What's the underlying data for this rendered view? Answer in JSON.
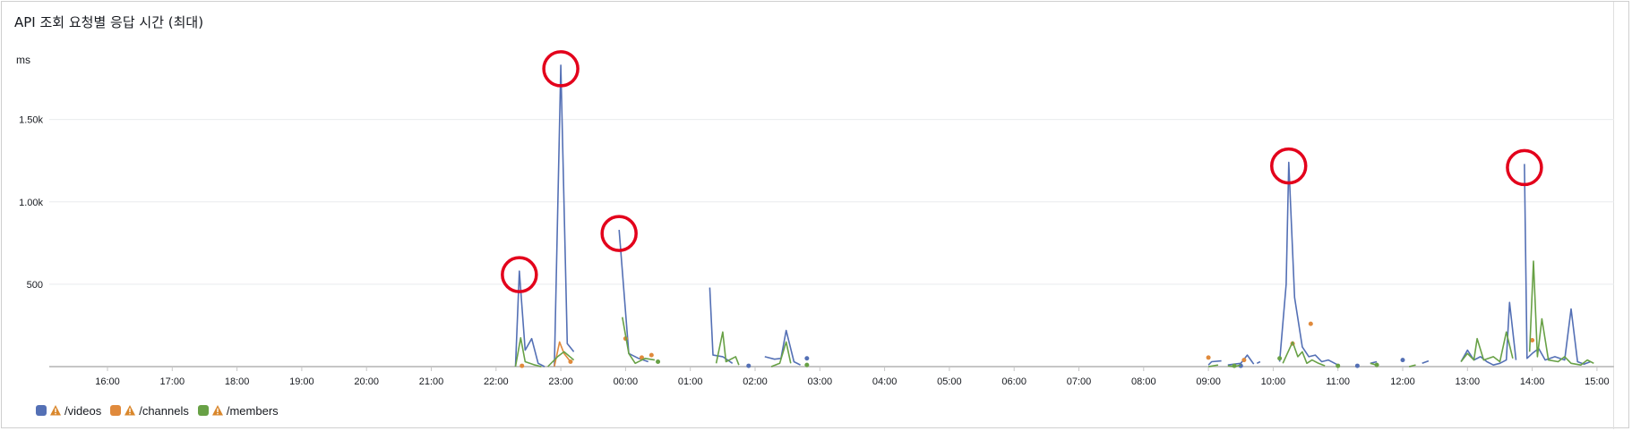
{
  "panel": {
    "title": "API 조회 요청별 응답 시간 (최대)",
    "unit": "ms"
  },
  "colors": {
    "videos": "#5470b5",
    "channels": "#e08a3c",
    "members": "#68a146",
    "grid": "#e9ebed",
    "axis": "#c6c6c6",
    "highlight": "#e3001b",
    "warning": "#d9872c"
  },
  "chart_data": {
    "type": "line",
    "title": "API 조회 요청별 응답 시간 (최대)",
    "ylabel": "ms",
    "ylim": [
      0,
      1900
    ],
    "yticks": [
      {
        "value": 500,
        "label": "500"
      },
      {
        "value": 1000,
        "label": "1.00k"
      },
      {
        "value": 1500,
        "label": "1.50k"
      }
    ],
    "xlim": [
      15.6,
      39.1
    ],
    "xticks": [
      {
        "value": 16,
        "label": "16:00"
      },
      {
        "value": 17,
        "label": "17:00"
      },
      {
        "value": 18,
        "label": "18:00"
      },
      {
        "value": 19,
        "label": "19:00"
      },
      {
        "value": 20,
        "label": "20:00"
      },
      {
        "value": 21,
        "label": "21:00"
      },
      {
        "value": 22,
        "label": "22:00"
      },
      {
        "value": 23,
        "label": "23:00"
      },
      {
        "value": 24,
        "label": "00:00"
      },
      {
        "value": 25,
        "label": "01:00"
      },
      {
        "value": 26,
        "label": "02:00"
      },
      {
        "value": 27,
        "label": "03:00"
      },
      {
        "value": 28,
        "label": "04:00"
      },
      {
        "value": 29,
        "label": "05:00"
      },
      {
        "value": 30,
        "label": "06:00"
      },
      {
        "value": 31,
        "label": "07:00"
      },
      {
        "value": 32,
        "label": "08:00"
      },
      {
        "value": 33,
        "label": "09:00"
      },
      {
        "value": 34,
        "label": "10:00"
      },
      {
        "value": 35,
        "label": "11:00"
      },
      {
        "value": 36,
        "label": "12:00"
      },
      {
        "value": 37,
        "label": "13:00"
      },
      {
        "value": 38,
        "label": "14:00"
      },
      {
        "value": 39,
        "label": "15:00"
      }
    ],
    "grid": true,
    "legend_position": "bottom-left",
    "series": [
      {
        "name": "/videos",
        "segments": [
          [
            [
              22.3,
              0
            ],
            [
              22.36,
              580
            ],
            [
              22.45,
              100
            ],
            [
              22.55,
              170
            ],
            [
              22.65,
              20
            ],
            [
              22.75,
              0
            ]
          ],
          [
            [
              22.9,
              0
            ],
            [
              23.0,
              1830
            ],
            [
              23.1,
              140
            ],
            [
              23.2,
              90
            ]
          ],
          [
            [
              23.9,
              830
            ],
            [
              24.05,
              80
            ],
            [
              24.2,
              50
            ],
            [
              24.35,
              30
            ]
          ],
          [
            [
              25.3,
              480
            ],
            [
              25.35,
              70
            ],
            [
              25.5,
              60
            ],
            [
              25.65,
              20
            ]
          ],
          [
            [
              26.15,
              60
            ],
            [
              26.3,
              45
            ],
            [
              26.4,
              50
            ],
            [
              26.48,
              220
            ],
            [
              26.6,
              30
            ],
            [
              26.7,
              10
            ]
          ],
          [
            [
              33.0,
              10
            ],
            [
              33.05,
              30
            ],
            [
              33.2,
              35
            ]
          ],
          [
            [
              33.3,
              10
            ],
            [
              33.4,
              15
            ],
            [
              33.5,
              20
            ],
            [
              33.6,
              70
            ],
            [
              33.7,
              15
            ]
          ],
          [
            [
              33.75,
              20
            ],
            [
              33.8,
              30
            ]
          ],
          [
            [
              34.1,
              30
            ],
            [
              34.2,
              500
            ],
            [
              34.24,
              1240
            ],
            [
              34.33,
              420
            ],
            [
              34.45,
              120
            ],
            [
              34.55,
              60
            ],
            [
              34.65,
              70
            ],
            [
              34.75,
              30
            ],
            [
              34.85,
              40
            ],
            [
              35.0,
              10
            ]
          ],
          [
            [
              35.5,
              20
            ],
            [
              35.6,
              30
            ]
          ],
          [
            [
              36.3,
              20
            ],
            [
              36.4,
              35
            ]
          ],
          [
            [
              36.9,
              30
            ],
            [
              37.0,
              100
            ],
            [
              37.1,
              40
            ],
            [
              37.2,
              60
            ],
            [
              37.3,
              30
            ],
            [
              37.4,
              10
            ],
            [
              37.5,
              20
            ],
            [
              37.6,
              40
            ],
            [
              37.65,
              390
            ],
            [
              37.75,
              40
            ]
          ],
          [
            [
              37.88,
              1230
            ],
            [
              37.92,
              50
            ],
            [
              38.0,
              80
            ],
            [
              38.1,
              110
            ],
            [
              38.2,
              40
            ],
            [
              38.35,
              60
            ],
            [
              38.5,
              40
            ],
            [
              38.6,
              350
            ],
            [
              38.7,
              30
            ],
            [
              38.8,
              15
            ],
            [
              38.9,
              30
            ]
          ]
        ],
        "dots": [
          [
            26.8,
            50
          ],
          [
            25.9,
            5
          ],
          [
            33.5,
            5
          ],
          [
            35.3,
            5
          ],
          [
            36.0,
            40
          ]
        ]
      },
      {
        "name": "/channels",
        "segments": [
          [
            [
              22.9,
              0
            ],
            [
              22.98,
              150
            ],
            [
              23.05,
              80
            ],
            [
              23.15,
              30
            ]
          ]
        ],
        "dots": [
          [
            22.4,
            5
          ],
          [
            23.15,
            30
          ],
          [
            24.0,
            170
          ],
          [
            24.25,
            55
          ],
          [
            24.4,
            70
          ],
          [
            33.0,
            55
          ],
          [
            33.55,
            40
          ],
          [
            34.3,
            140
          ],
          [
            34.58,
            260
          ],
          [
            38.0,
            160
          ]
        ]
      },
      {
        "name": "/members",
        "segments": [
          [
            [
              22.3,
              0
            ],
            [
              22.38,
              175
            ],
            [
              22.45,
              30
            ],
            [
              22.6,
              10
            ],
            [
              22.7,
              0
            ]
          ],
          [
            [
              22.8,
              0
            ],
            [
              22.95,
              60
            ],
            [
              23.05,
              90
            ],
            [
              23.2,
              40
            ]
          ],
          [
            [
              23.95,
              300
            ],
            [
              24.05,
              80
            ],
            [
              24.15,
              20
            ],
            [
              24.3,
              50
            ],
            [
              24.45,
              40
            ]
          ],
          [
            [
              25.4,
              20
            ],
            [
              25.5,
              210
            ],
            [
              25.55,
              30
            ],
            [
              25.7,
              60
            ],
            [
              25.75,
              10
            ]
          ],
          [
            [
              26.25,
              0
            ],
            [
              26.38,
              20
            ],
            [
              26.48,
              150
            ],
            [
              26.55,
              20
            ]
          ],
          [
            [
              33.0,
              0
            ],
            [
              33.15,
              10
            ]
          ],
          [
            [
              33.3,
              5
            ],
            [
              33.4,
              0
            ],
            [
              33.5,
              10
            ]
          ],
          [
            [
              34.15,
              20
            ],
            [
              34.3,
              150
            ],
            [
              34.38,
              60
            ],
            [
              34.45,
              90
            ],
            [
              34.52,
              20
            ],
            [
              34.6,
              40
            ],
            [
              34.7,
              20
            ],
            [
              34.8,
              5
            ]
          ],
          [
            [
              35.5,
              20
            ],
            [
              35.6,
              10
            ]
          ],
          [
            [
              36.1,
              0
            ],
            [
              36.2,
              10
            ]
          ],
          [
            [
              36.9,
              30
            ],
            [
              37.0,
              80
            ],
            [
              37.1,
              40
            ],
            [
              37.15,
              170
            ],
            [
              37.25,
              40
            ],
            [
              37.4,
              60
            ],
            [
              37.5,
              30
            ],
            [
              37.6,
              210
            ],
            [
              37.7,
              50
            ]
          ],
          [
            [
              37.96,
              90
            ],
            [
              38.02,
              640
            ],
            [
              38.08,
              60
            ],
            [
              38.15,
              290
            ],
            [
              38.25,
              40
            ],
            [
              38.4,
              30
            ],
            [
              38.5,
              60
            ],
            [
              38.6,
              20
            ],
            [
              38.75,
              10
            ],
            [
              38.85,
              40
            ],
            [
              38.95,
              20
            ]
          ]
        ],
        "dots": [
          [
            24.5,
            30
          ],
          [
            26.8,
            10
          ],
          [
            33.4,
            5
          ],
          [
            34.1,
            50
          ],
          [
            35.0,
            5
          ],
          [
            35.6,
            10
          ]
        ]
      }
    ],
    "highlight_circles": [
      {
        "x": 22.36,
        "y": 580
      },
      {
        "x": 23.0,
        "y": 1830
      },
      {
        "x": 23.9,
        "y": 830
      },
      {
        "x": 34.24,
        "y": 1240
      },
      {
        "x": 37.88,
        "y": 1230
      }
    ]
  },
  "legend": {
    "items": [
      {
        "label": "/videos",
        "color": "#5470b5"
      },
      {
        "label": "/channels",
        "color": "#e08a3c"
      },
      {
        "label": "/members",
        "color": "#68a146"
      }
    ]
  }
}
